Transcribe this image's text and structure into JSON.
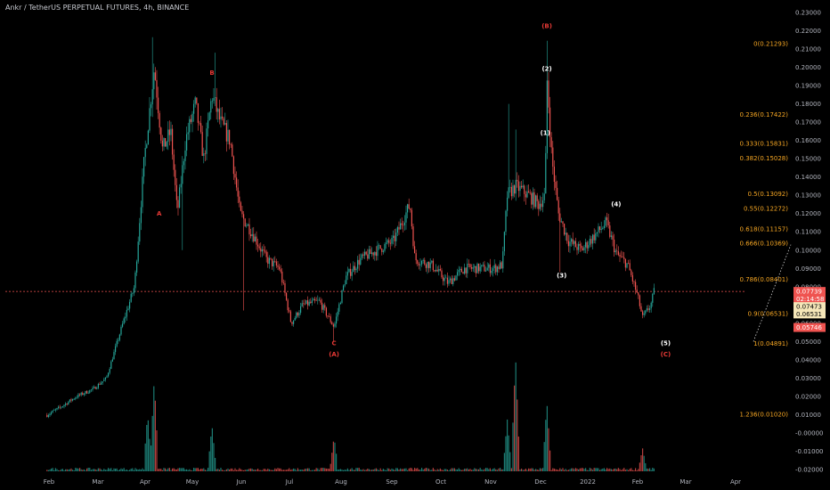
{
  "title": "Ankr / TetherUS PERPETUAL FUTURES, 4h, BINANCE",
  "colors": {
    "background": "#000000",
    "up": "#26a69a",
    "down": "#ef5350",
    "fib": "#f5a623",
    "wave_white": "#ffffff",
    "wave_red": "#e53935",
    "axis_text": "#b2b5be",
    "current_line": "#ef5350"
  },
  "chart_data": {
    "type": "candlestick",
    "y_axis": {
      "ticks": [
        "0.23000",
        "0.22000",
        "0.21000",
        "0.20000",
        "0.19000",
        "0.18000",
        "0.17000",
        "0.16000",
        "0.15000",
        "0.14000",
        "0.13000",
        "0.12000",
        "0.11000",
        "0.10000",
        "0.09000",
        "0.08000",
        "0.07000",
        "0.06000",
        "0.05000",
        "0.04000",
        "0.03000",
        "0.02000",
        "0.01000",
        "-0.00000",
        "-0.01000",
        "-0.02000"
      ],
      "ylim": [
        -0.02,
        0.23
      ]
    },
    "x_axis": {
      "ticks": [
        "Feb",
        "Mar",
        "Apr",
        "May",
        "Jun",
        "Jul",
        "Aug",
        "Sep",
        "Oct",
        "Nov",
        "Dec",
        "2022",
        "Feb",
        "Mar",
        "Apr"
      ]
    },
    "price_path": [
      [
        "2021-01-28",
        0.0098
      ],
      [
        "2021-02-05",
        0.014
      ],
      [
        "2021-02-15",
        0.02
      ],
      [
        "2021-02-25",
        0.024
      ],
      [
        "2021-03-05",
        0.03
      ],
      [
        "2021-03-15",
        0.06
      ],
      [
        "2021-03-22",
        0.08
      ],
      [
        "2021-03-28",
        0.15
      ],
      [
        "2021-04-03",
        0.2
      ],
      [
        "2021-04-08",
        0.155
      ],
      [
        "2021-04-13",
        0.165
      ],
      [
        "2021-04-17",
        0.12
      ],
      [
        "2021-04-22",
        0.16
      ],
      [
        "2021-04-28",
        0.18
      ],
      [
        "2021-05-03",
        0.15
      ],
      [
        "2021-05-08",
        0.185
      ],
      [
        "2021-05-13",
        0.17
      ],
      [
        "2021-05-19",
        0.16
      ],
      [
        "2021-05-25",
        0.12
      ],
      [
        "2021-06-01",
        0.11
      ],
      [
        "2021-06-10",
        0.095
      ],
      [
        "2021-06-18",
        0.09
      ],
      [
        "2021-06-25",
        0.06
      ],
      [
        "2021-07-02",
        0.07
      ],
      [
        "2021-07-12",
        0.072
      ],
      [
        "2021-07-21",
        0.058
      ],
      [
        "2021-07-28",
        0.085
      ],
      [
        "2021-08-06",
        0.095
      ],
      [
        "2021-08-16",
        0.1
      ],
      [
        "2021-08-26",
        0.105
      ],
      [
        "2021-09-05",
        0.125
      ],
      [
        "2021-09-08",
        0.095
      ],
      [
        "2021-09-18",
        0.092
      ],
      [
        "2021-09-28",
        0.082
      ],
      [
        "2021-10-08",
        0.09
      ],
      [
        "2021-10-18",
        0.09
      ],
      [
        "2021-10-26",
        0.09
      ],
      [
        "2021-10-31",
        0.092
      ],
      [
        "2021-11-03",
        0.13
      ],
      [
        "2021-11-08",
        0.135
      ],
      [
        "2021-11-16",
        0.13
      ],
      [
        "2021-11-22",
        0.125
      ],
      [
        "2021-11-26",
        0.13
      ],
      [
        "2021-11-27",
        0.195
      ],
      [
        "2021-11-30",
        0.15
      ],
      [
        "2021-12-04",
        0.12
      ],
      [
        "2021-12-10",
        0.105
      ],
      [
        "2021-12-18",
        0.1
      ],
      [
        "2021-12-26",
        0.108
      ],
      [
        "2022-01-02",
        0.115
      ],
      [
        "2022-01-08",
        0.098
      ],
      [
        "2022-01-15",
        0.092
      ],
      [
        "2022-01-21",
        0.075
      ],
      [
        "2022-01-24",
        0.063
      ],
      [
        "2022-01-29",
        0.07
      ],
      [
        "2022-01-31",
        0.0774
      ]
    ],
    "fib_levels": [
      {
        "label": "0(0.21293)",
        "value": 0.21293
      },
      {
        "label": "0.236(0.17422)",
        "value": 0.17422
      },
      {
        "label": "0.333(0.15831)",
        "value": 0.15831
      },
      {
        "label": "0.382(0.15028)",
        "value": 0.15028
      },
      {
        "label": "0.5(0.13092)",
        "value": 0.13092
      },
      {
        "label": "0.55(0.12272)",
        "value": 0.12272
      },
      {
        "label": "0.618(0.11157)",
        "value": 0.11157
      },
      {
        "label": "0.666(0.10369)",
        "value": 0.10369
      },
      {
        "label": "0.786(0.08401)",
        "value": 0.08401
      },
      {
        "label": "0.9(0.06531)",
        "value": 0.06531
      },
      {
        "label": "1(0.04891)",
        "value": 0.04891
      },
      {
        "label": "1.236(0.01020)",
        "value": 0.0102
      }
    ],
    "wave_labels": [
      {
        "text": "A",
        "date": "2021-04-06",
        "price": 0.119,
        "color": "red"
      },
      {
        "text": "B",
        "date": "2021-05-08",
        "price": 0.196,
        "color": "red"
      },
      {
        "text": "C",
        "date": "2021-07-21",
        "price": 0.048,
        "color": "red"
      },
      {
        "text": "(A)",
        "date": "2021-07-21",
        "price": 0.042,
        "color": "red"
      },
      {
        "text": "(B)",
        "date": "2021-11-27",
        "price": 0.2215,
        "color": "red"
      },
      {
        "text": "(2)",
        "date": "2021-11-27",
        "price": 0.198,
        "color": "white"
      },
      {
        "text": "(1)",
        "date": "2021-11-26",
        "price": 0.163,
        "color": "white"
      },
      {
        "text": "(3)",
        "date": "2021-12-06",
        "price": 0.085,
        "color": "white"
      },
      {
        "text": "(4)",
        "date": "2022-01-08",
        "price": 0.124,
        "color": "white"
      },
      {
        "text": "(5)",
        "date": "2022-02-07",
        "price": 0.048,
        "color": "white"
      },
      {
        "text": "(C)",
        "date": "2022-02-07",
        "price": 0.042,
        "color": "red"
      }
    ],
    "price_tags": [
      {
        "text": "0.07739",
        "value": 0.07739,
        "bg": "#ef5350",
        "fg": "#ffffff"
      },
      {
        "text": "02:14:58",
        "value": 0.07339,
        "bg": "#ef5350",
        "fg": "#ffffff"
      },
      {
        "text": "0.07473",
        "value": 0.0691,
        "bg": "#f5e6b8",
        "fg": "#000000"
      },
      {
        "text": "0.06531",
        "value": 0.0651,
        "bg": "#f5e6b8",
        "fg": "#000000"
      },
      {
        "text": "0.05746",
        "value": 0.0577,
        "bg": "#ef5350",
        "fg": "#ffffff"
      }
    ],
    "current_price": 0.07739,
    "volume_spikes": [
      [
        "2021-03-30",
        0.5
      ],
      [
        "2021-04-03",
        0.8
      ],
      [
        "2021-05-08",
        0.4
      ],
      [
        "2021-07-21",
        0.3
      ],
      [
        "2021-11-03",
        0.45
      ],
      [
        "2021-11-08",
        1.0
      ],
      [
        "2021-11-27",
        0.6
      ],
      [
        "2022-01-24",
        0.2
      ]
    ],
    "grid": false,
    "legend": "none"
  }
}
